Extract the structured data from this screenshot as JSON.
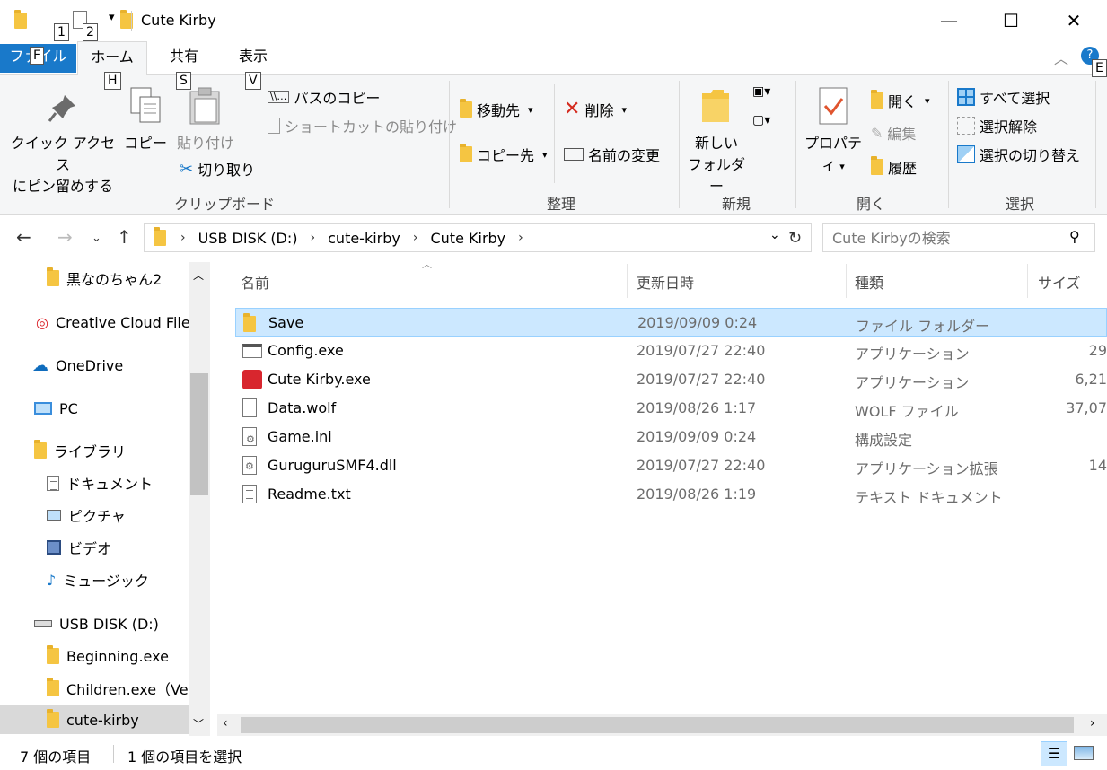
{
  "window": {
    "title": "Cute Kirby",
    "minimize": "—",
    "maximize": "☐",
    "close": "✕"
  },
  "keytips": {
    "qat1": "1",
    "qat2": "2",
    "file": "F",
    "home": "H",
    "share": "S",
    "view": "V",
    "help": "E"
  },
  "tabs": {
    "file": "ファイル",
    "home": "ホーム",
    "share": "共有",
    "view": "表示"
  },
  "ribbon": {
    "clipboard": {
      "pin_line1": "クイック アクセス",
      "pin_line2": "にピン留めする",
      "copy": "コピー",
      "paste": "貼り付け",
      "copy_path": "パスのコピー",
      "paste_shortcut": "ショートカットの貼り付け",
      "cut": "切り取り",
      "label": "クリップボード"
    },
    "organize": {
      "move_to": "移動先",
      "copy_to": "コピー先",
      "delete": "削除",
      "rename": "名前の変更",
      "label": "整理"
    },
    "new": {
      "new_folder_line1": "新しい",
      "new_folder_line2": "フォルダー",
      "label": "新規"
    },
    "open": {
      "properties": "プロパティ",
      "open": "開く",
      "edit": "編集",
      "history": "履歴",
      "label": "開く"
    },
    "select": {
      "select_all": "すべて選択",
      "select_none": "選択解除",
      "invert": "選択の切り替え",
      "label": "選択"
    }
  },
  "address": {
    "crumbs": [
      "USB DISK (D:)",
      "cute-kirby",
      "Cute Kirby"
    ],
    "search_placeholder": "Cute Kirbyの検索"
  },
  "sidebar": {
    "items": [
      {
        "label": "黒なのちゃん2"
      },
      {
        "label": "Creative Cloud Files"
      },
      {
        "label": "OneDrive"
      },
      {
        "label": "PC"
      },
      {
        "label": "ライブラリ"
      },
      {
        "label": "ドキュメント"
      },
      {
        "label": "ピクチャ"
      },
      {
        "label": "ビデオ"
      },
      {
        "label": "ミュージック"
      },
      {
        "label": "USB DISK (D:)"
      },
      {
        "label": "Beginning.exe"
      },
      {
        "label": "Children.exe（Ver"
      },
      {
        "label": "cute-kirby"
      }
    ]
  },
  "columns": {
    "name": "名前",
    "date": "更新日時",
    "type": "種類",
    "size": "サイズ"
  },
  "files": [
    {
      "name": "Save",
      "date": "2019/09/09 0:24",
      "type": "ファイル フォルダー",
      "size": ""
    },
    {
      "name": "Config.exe",
      "date": "2019/07/27 22:40",
      "type": "アプリケーション",
      "size": "29"
    },
    {
      "name": "Cute Kirby.exe",
      "date": "2019/07/27 22:40",
      "type": "アプリケーション",
      "size": "6,21"
    },
    {
      "name": "Data.wolf",
      "date": "2019/08/26 1:17",
      "type": "WOLF ファイル",
      "size": "37,07"
    },
    {
      "name": "Game.ini",
      "date": "2019/09/09 0:24",
      "type": "構成設定",
      "size": ""
    },
    {
      "name": "GuruguruSMF4.dll",
      "date": "2019/07/27 22:40",
      "type": "アプリケーション拡張",
      "size": "14"
    },
    {
      "name": "Readme.txt",
      "date": "2019/08/26 1:19",
      "type": "テキスト ドキュメント",
      "size": ""
    }
  ],
  "status": {
    "count": "7 個の項目",
    "selected": "1 個の項目を選択"
  },
  "colors": {
    "accent": "#1979ca",
    "selection": "#cce8ff",
    "folder": "#f5c542"
  }
}
